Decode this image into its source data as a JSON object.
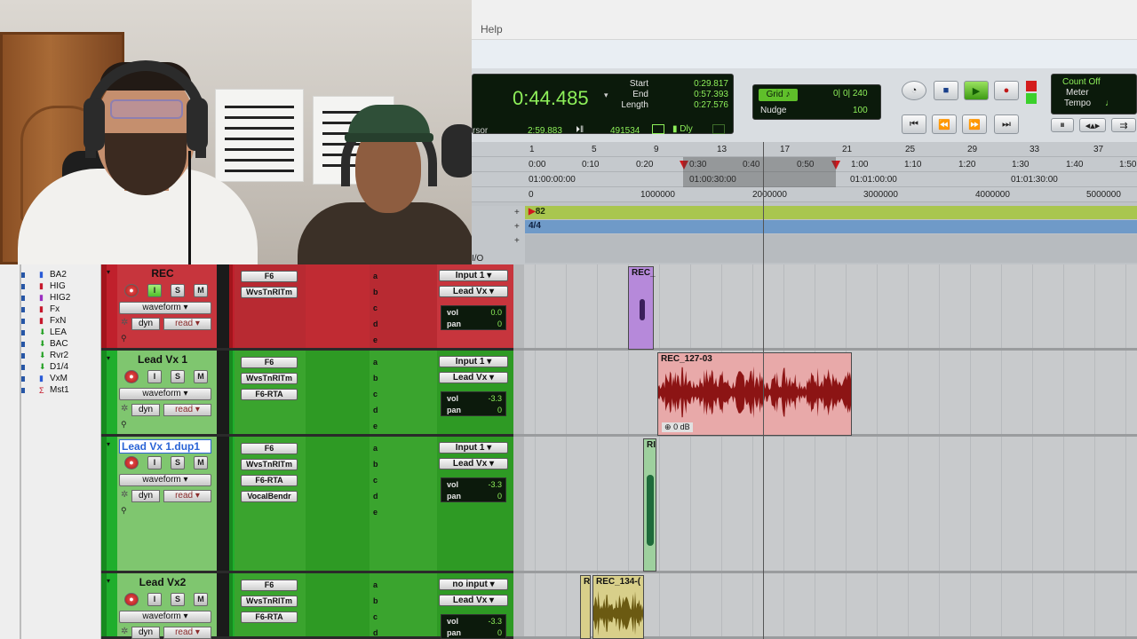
{
  "menu": {
    "help": "Help"
  },
  "transport": {
    "main_counter": "0:44.485",
    "start_label": "Start",
    "start_value": "0:29.817",
    "end_label": "End",
    "end_value": "0:57.393",
    "length_label": "Length",
    "length_value": "0:27.576",
    "cursor_label": "rsor",
    "cursor_value": "2:59.883",
    "samples_value": "491534",
    "dly_label": "Dly",
    "grid_label": "Grid",
    "grid_value": "0| 0| 240",
    "nudge_label": "Nudge",
    "nudge_value": "100",
    "count_off": "Count Off",
    "meter": "Meter",
    "tempo": "Tempo"
  },
  "rulers": {
    "bars": [
      "1",
      "5",
      "9",
      "13",
      "17",
      "21",
      "25",
      "29",
      "33",
      "37"
    ],
    "minsecs": [
      "0:00",
      "0:10",
      "0:20",
      "0:30",
      "0:40",
      "0:50",
      "1:00",
      "1:10",
      "1:20",
      "1:30",
      "1:40",
      "1:50"
    ],
    "timecode": [
      "01:00:00:00",
      "01:00:30:00",
      "01:01:00:00",
      "01:01:30:00"
    ],
    "samples": [
      "0",
      "1000000",
      "2000000",
      "3000000",
      "4000000",
      "5000000"
    ],
    "marker": "82",
    "meter": "4/4",
    "io_tab": "I/O"
  },
  "tracklist": [
    {
      "name": "BA2",
      "color": "#2a5bd7"
    },
    {
      "name": "HIG",
      "color": "#c6182c"
    },
    {
      "name": "HIG2",
      "color": "#9b2fc0"
    },
    {
      "name": "Fx",
      "color": "#c6182c"
    },
    {
      "name": "FxN",
      "color": "#c6182c"
    },
    {
      "name": "LEA",
      "color": "#23a023"
    },
    {
      "name": "BAC",
      "color": "#23a023"
    },
    {
      "name": "Rvr2",
      "color": "#23a023"
    },
    {
      "name": "D1/4",
      "color": "#23a023"
    },
    {
      "name": "VxM",
      "color": "#2a5bd7"
    },
    {
      "name": "Mst1",
      "color": "#c6182c"
    }
  ],
  "tracks": [
    {
      "name": "REC",
      "view": "waveform",
      "dyn": "dyn",
      "auto": "read",
      "inserts": [
        "F6",
        "WvsTnRITm"
      ],
      "sends": [
        "a",
        "b",
        "c",
        "d",
        "e"
      ],
      "input": "Input 1",
      "output": "Lead Vx",
      "vol_label": "vol",
      "vol": "0.0",
      "pan_label": "pan",
      "pan": "0",
      "color": "#c0202c"
    },
    {
      "name": "Lead Vx 1",
      "view": "waveform",
      "dyn": "dyn",
      "auto": "read",
      "inserts": [
        "F6",
        "WvsTnRITm",
        "F6-RTA"
      ],
      "sends": [
        "a",
        "b",
        "c",
        "d",
        "e"
      ],
      "input": "Input 1",
      "output": "Lead Vx",
      "vol_label": "vol",
      "vol": "-3.3",
      "pan_label": "pan",
      "pan": "0",
      "color": "#1fae2c"
    },
    {
      "name": "Lead Vx 1.dup1",
      "view": "waveform",
      "dyn": "dyn",
      "auto": "read",
      "inserts": [
        "F6",
        "WvsTnRITm",
        "F6-RTA",
        "VocalBendr"
      ],
      "sends": [
        "a",
        "b",
        "c",
        "d",
        "e"
      ],
      "input": "Input 1",
      "output": "Lead Vx",
      "vol_label": "vol",
      "vol": "-3.3",
      "pan_label": "pan",
      "pan": "0",
      "color": "#1fae2c"
    },
    {
      "name": "Lead Vx2",
      "view": "waveform",
      "dyn": "dyn",
      "auto": "read",
      "inserts": [
        "F6",
        "WvsTnRITm",
        "F6-RTA"
      ],
      "sends": [
        "a",
        "b",
        "c",
        "d"
      ],
      "input": "no input",
      "output": "Lead Vx",
      "vol_label": "vol",
      "vol": "-3.3",
      "pan_label": "pan",
      "pan": "0",
      "color": "#1fae2c"
    }
  ],
  "clips": {
    "rec": "REC_",
    "rec127": "REC_127-03",
    "rec127_gain": "0 dB",
    "dup": "RI",
    "r": "R",
    "rec134": "REC_134-("
  },
  "buttons": {
    "mute": "M",
    "solo": "S",
    "input": "I"
  }
}
